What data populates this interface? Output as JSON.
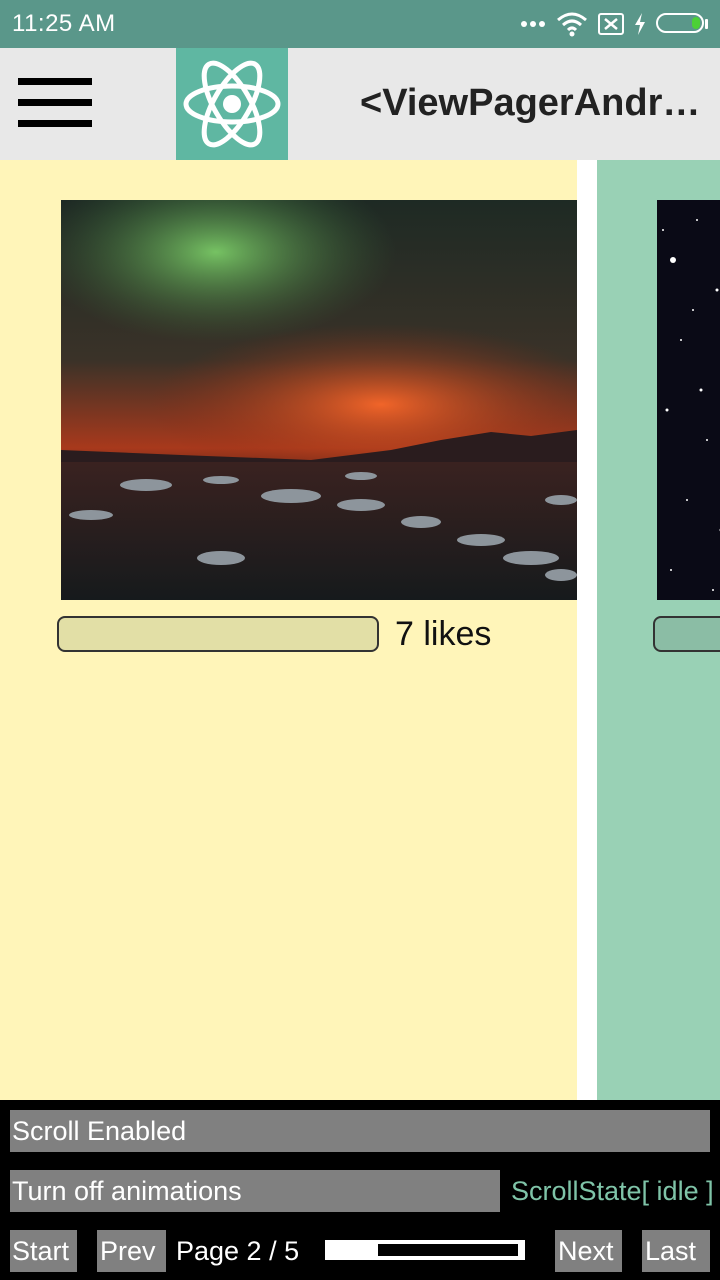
{
  "status_bar": {
    "time": "11:25  AM",
    "icons": [
      "more-dots-icon",
      "wifi-icon",
      "no-sim-icon",
      "charging-icon",
      "battery-icon"
    ],
    "battery_level": 0.15
  },
  "app_bar": {
    "title": "<ViewPagerAndroid>",
    "menu_icon": "menu-icon",
    "logo": "react-logo-icon"
  },
  "pages": [
    {
      "background": "#fff5b9",
      "image": "aurora-landscape-photo",
      "likes_text": "7 likes"
    },
    {
      "background": "#99d1b5",
      "image": "starfield-photo"
    }
  ],
  "controls": {
    "scroll_enabled_label": "Scroll Enabled",
    "animations_label": "Turn off animations",
    "scroll_state": "ScrollState[ idle ]",
    "start_label": "Start",
    "prev_label": "Prev",
    "page_label": "Page 2 / 5",
    "progress": 0.2,
    "next_label": "Next",
    "last_label": "Last"
  },
  "colors": {
    "status_bar": "#5a978a",
    "logo_bg": "#5fb7a2",
    "button_gray": "#808080",
    "scroll_state_text": "#7fc4a8"
  }
}
